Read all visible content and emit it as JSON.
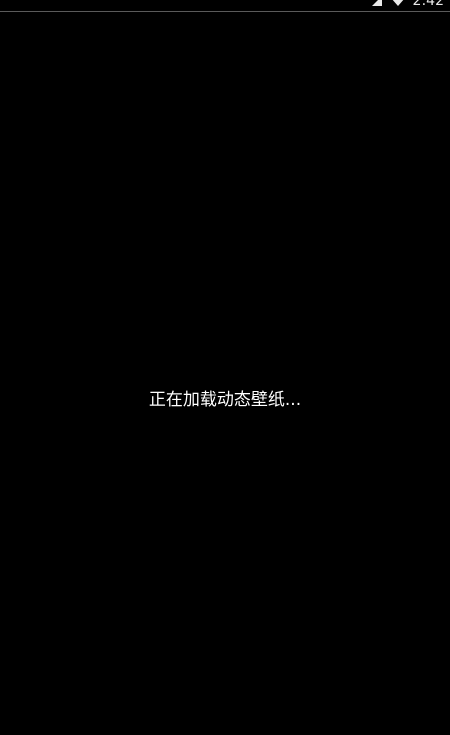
{
  "status_bar": {
    "time": "2:42",
    "icons": [
      "signal-icon",
      "wifi-icon"
    ]
  },
  "main": {
    "loading_message": "正在加载动态壁纸..."
  },
  "colors": {
    "background": "#000000",
    "text": "#ffffff",
    "status_text": "#e8e8e8"
  }
}
